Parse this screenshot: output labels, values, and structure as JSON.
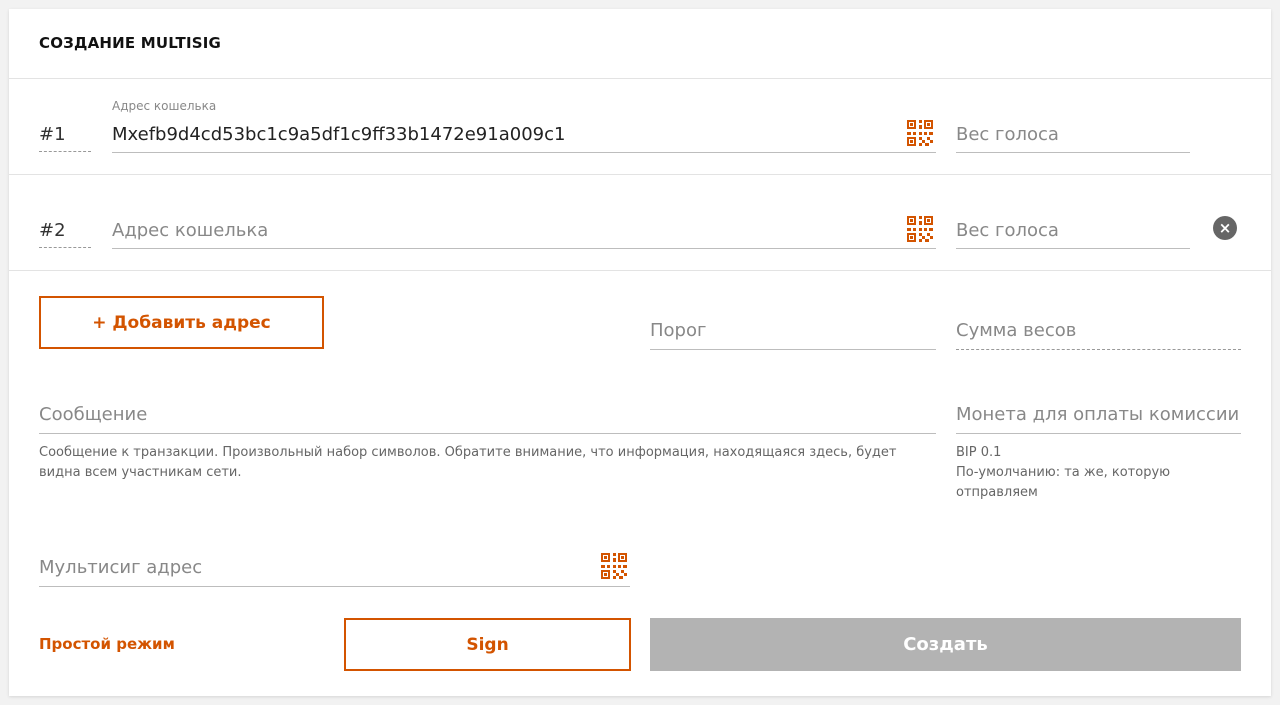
{
  "header": {
    "title": "СОЗДАНИЕ MULTISIG"
  },
  "rows": [
    {
      "number": "#1",
      "address_label": "Адрес кошелька",
      "address_value": "Mxefb9d4cd53bc1c9a5df1c9ff33b1472e91a009c1",
      "weight_placeholder": "Вес голоса"
    },
    {
      "number": "#2",
      "address_placeholder": "Адрес кошелька",
      "weight_placeholder": "Вес голоса"
    }
  ],
  "add_address_label": "+ Добавить адрес",
  "threshold_placeholder": "Порог",
  "weights_sum_placeholder": "Сумма весов",
  "message": {
    "placeholder": "Сообщение",
    "hint": "Сообщение к транзакции. Произвольный набор символов. Обратите внимание, что информация, находящаяся здесь, будет видна всем участникам сети."
  },
  "fee_coin": {
    "label": "Монета для оплаты комиссии",
    "value": "BIP 0.1",
    "hint": "По-умолчанию: та же, которую отправляем"
  },
  "multisig_address_placeholder": "Мультисиг адрес",
  "footer": {
    "simple_mode_label": "Простой режим",
    "sign_label": "Sign",
    "create_label": "Создать"
  },
  "icons": {
    "qr": "qr-code-icon",
    "close": "close-circle-icon"
  },
  "colors": {
    "accent": "#d35400",
    "disabled": "#b3b3b3"
  }
}
